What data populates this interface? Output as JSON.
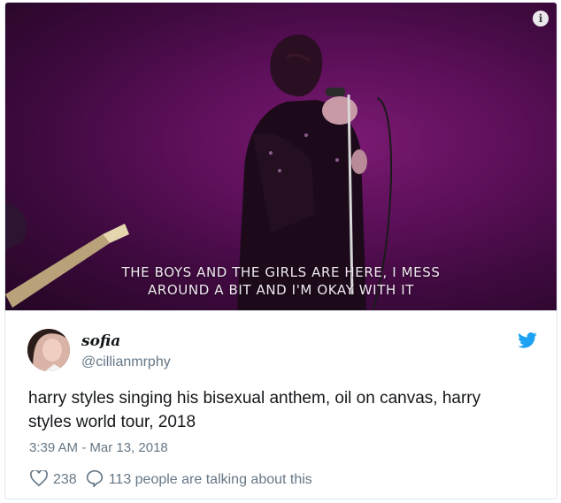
{
  "media": {
    "caption_line1": "THE BOYS AND THE GIRLS ARE HERE, I MESS",
    "caption_line2": "AROUND A BIT AND I'M OKAY WITH IT",
    "info_icon": "i"
  },
  "tweet": {
    "display_name": "sofia",
    "handle": "@cillianmrphy",
    "text": "harry styles singing his bisexual anthem, oil on canvas, harry styles world tour, 2018",
    "timestamp": "3:39 AM - Mar 13, 2018",
    "like_count": "238",
    "talking_text": "113 people are talking about this"
  },
  "colors": {
    "stage_purple": "#5c0f59",
    "twitter_blue": "#1da1f2",
    "meta_gray": "#657786"
  }
}
